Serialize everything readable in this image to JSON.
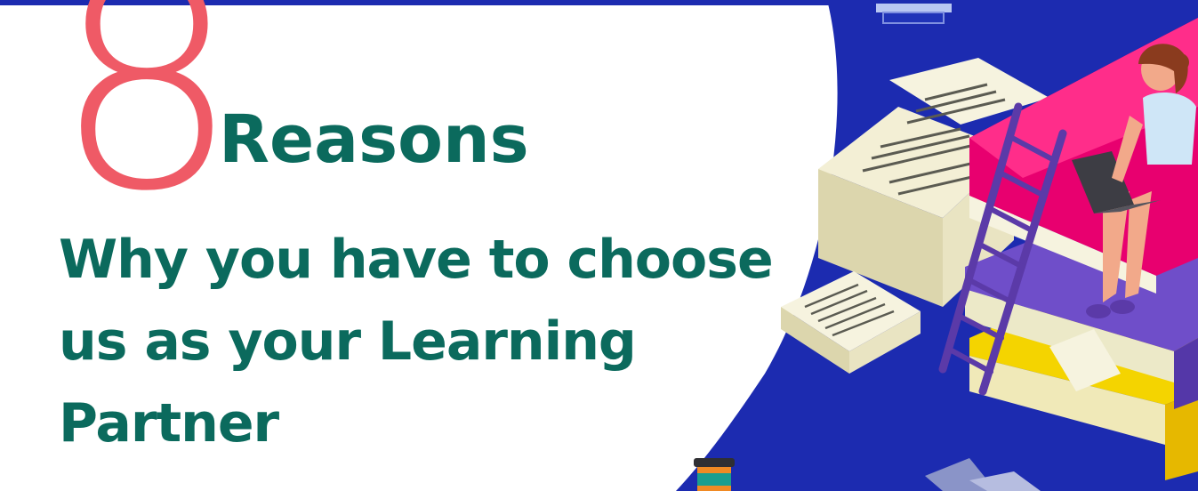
{
  "hero": {
    "number": "8",
    "headline": "Reasons",
    "subtitle_lines": [
      "Why you have to choose",
      "us as your Learning",
      "Partner"
    ]
  },
  "colors": {
    "number": "#ef5a66",
    "heading": "#0b6a5d",
    "background_blue": "#1c2bb0",
    "book_magenta": "#e8006f",
    "book_purple": "#6f4ec9",
    "book_yellow": "#f4d400",
    "paper": "#ece9c8"
  },
  "illustration": {
    "subject": "woman-on-stack-of-books-with-laptop"
  }
}
